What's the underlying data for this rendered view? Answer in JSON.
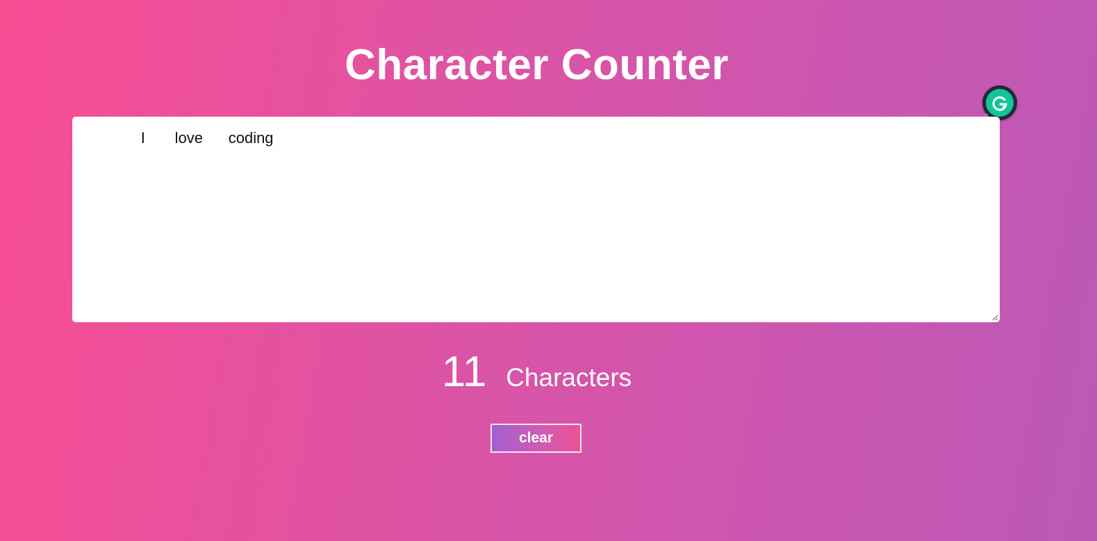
{
  "title": "Character Counter",
  "textarea": {
    "value": "       I       love      coding"
  },
  "counter": {
    "count": "11",
    "label": "Characters"
  },
  "buttons": {
    "clear_label": "clear"
  },
  "colors": {
    "gradient_start": "#f84d93",
    "gradient_end": "#bb59b7",
    "grammarly_green": "#15c39a"
  },
  "icons": {
    "grammarly": "grammarly-icon",
    "resize": "resize-handle-icon"
  }
}
